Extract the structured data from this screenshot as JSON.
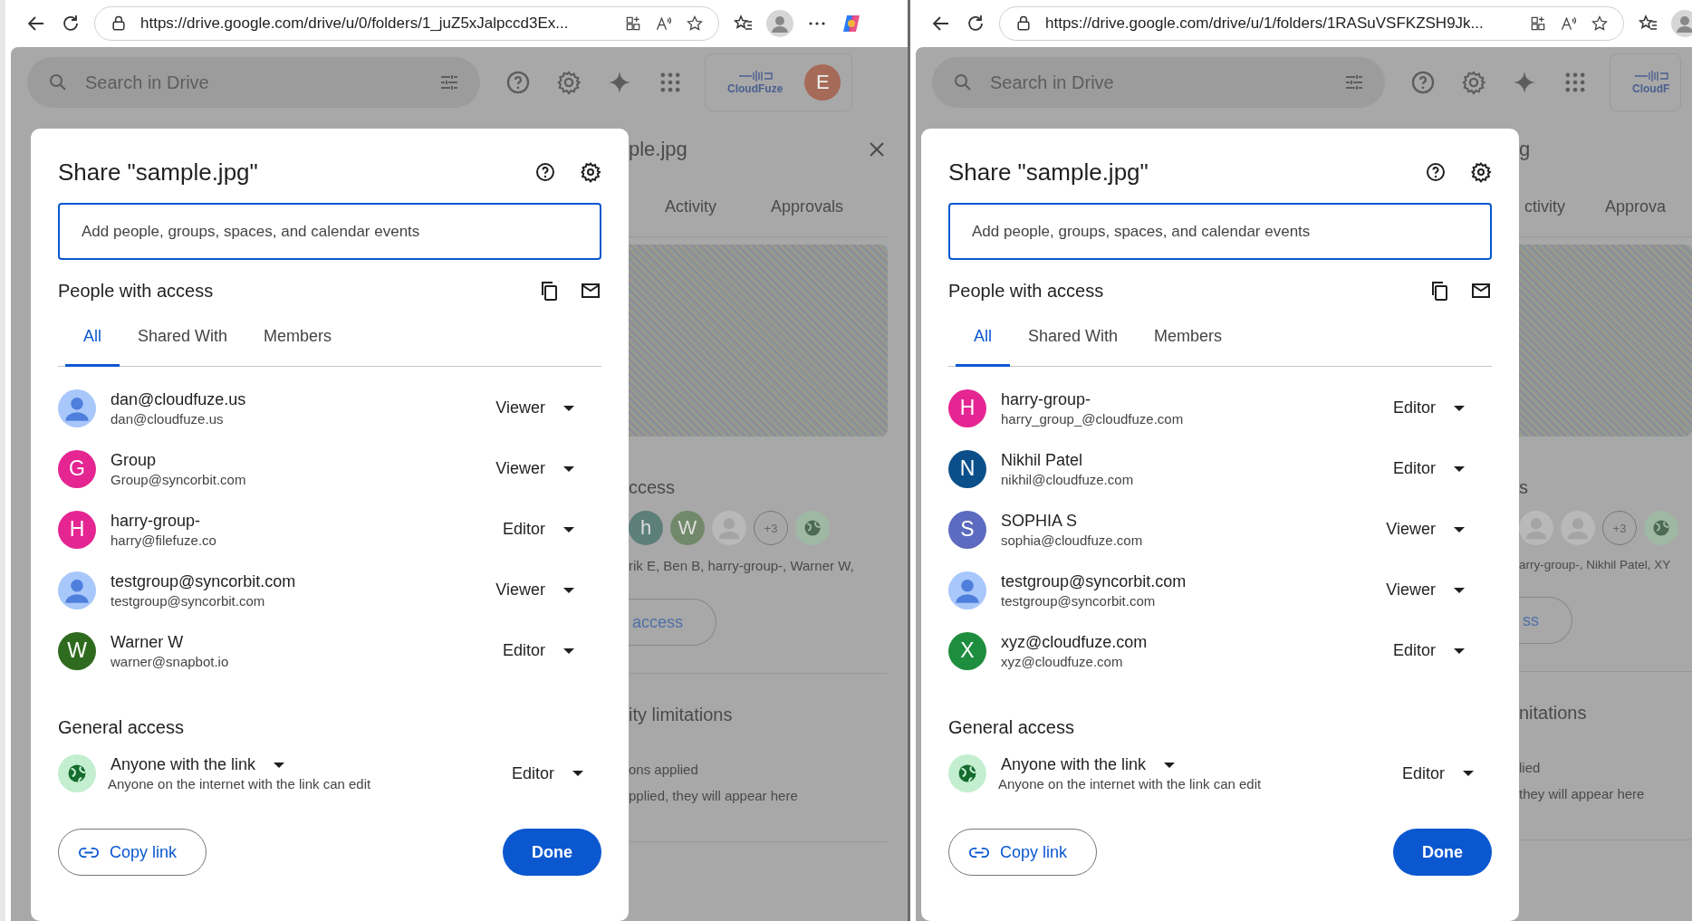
{
  "windows": [
    {
      "browser": {
        "url": "https://drive.google.com/drive/u/0/folders/1_juZ5xJalpccd3Ex..."
      },
      "drive_header": {
        "search": {
          "placeholder": "Search in Drive"
        },
        "logo_text": "CloudFuze",
        "avatar_letter": "E"
      },
      "details_panel": {
        "title": "ple.jpg",
        "close_visible": true,
        "tabs": [
          "Activity",
          "Approvals"
        ],
        "access_heading": "ccess",
        "avatars": [
          {
            "kind": "letter",
            "letter": "h",
            "color": "#5d7f7a"
          },
          {
            "kind": "letter",
            "letter": "W",
            "color": "#71896a"
          },
          {
            "kind": "person"
          },
          {
            "kind": "count",
            "letter": "+3"
          },
          {
            "kind": "globe"
          }
        ],
        "names": "rik E, Ben B, harry-group-, Warner W,",
        "manage_button": "access",
        "limits_heading": "ity limitations",
        "limits_line_1": "ons applied",
        "limits_line_2": "pplied, they will appear here"
      },
      "dialog": {
        "title": "Share \"sample.jpg\"",
        "input": {
          "placeholder": "Add people, groups, spaces, and calendar events"
        },
        "people_heading": "People with access",
        "tabs": [
          {
            "label": "All",
            "selected": true
          },
          {
            "label": "Shared With",
            "selected": false
          },
          {
            "label": "Members",
            "selected": false
          }
        ],
        "people": [
          {
            "name": "dan@cloudfuze.us",
            "email": "dan@cloudfuze.us",
            "role": "Viewer",
            "avatar": {
              "kind": "person"
            }
          },
          {
            "name": "Group",
            "email": "Group@syncorbit.com",
            "role": "Viewer",
            "avatar": {
              "kind": "letter",
              "letter": "G",
              "color": "#e52592"
            }
          },
          {
            "name": "harry-group-",
            "email": "harry@filefuze.co",
            "role": "Editor",
            "avatar": {
              "kind": "letter",
              "letter": "H",
              "color": "#e52592"
            }
          },
          {
            "name": "testgroup@syncorbit.com",
            "email": "testgroup@syncorbit.com",
            "role": "Viewer",
            "avatar": {
              "kind": "person"
            }
          },
          {
            "name": "Warner W",
            "email": "warner@snapbot.io",
            "role": "Editor",
            "avatar": {
              "kind": "letter",
              "letter": "W",
              "color": "#2e6b1f"
            }
          }
        ],
        "general_heading": "General access",
        "link": {
          "scope": "Anyone with the link",
          "description": "Anyone on the internet with the link can edit",
          "role": "Editor"
        },
        "copy_button": "Copy link",
        "done_button": "Done"
      }
    },
    {
      "browser": {
        "url": "https://drive.google.com/drive/u/1/folders/1RASuVSFKZSH9Jk..."
      },
      "drive_header": {
        "search": {
          "placeholder": "Search in Drive"
        },
        "logo_text": "CloudF"
      },
      "details_panel": {
        "title": "g",
        "close_visible": false,
        "tabs": [
          "ctivity",
          "Approva"
        ],
        "access_heading": "s",
        "avatars": [
          {
            "kind": "person"
          },
          {
            "kind": "person"
          },
          {
            "kind": "count",
            "letter": "+3"
          },
          {
            "kind": "globe"
          }
        ],
        "names": "arry-group-, Nikhil Patel, XY",
        "manage_button": "ss",
        "limits_heading": "nitations",
        "limits_line_1": "lied",
        "limits_line_2": "they will appear here"
      },
      "dialog": {
        "title": "Share \"sample.jpg\"",
        "input": {
          "placeholder": "Add people, groups, spaces, and calendar events"
        },
        "people_heading": "People with access",
        "tabs": [
          {
            "label": "All",
            "selected": true
          },
          {
            "label": "Shared With",
            "selected": false
          },
          {
            "label": "Members",
            "selected": false
          }
        ],
        "people": [
          {
            "name": "harry-group-",
            "email": "harry_group_@cloudfuze.com",
            "role": "Editor",
            "avatar": {
              "kind": "letter",
              "letter": "H",
              "color": "#e52592"
            }
          },
          {
            "name": "Nikhil Patel",
            "email": "nikhil@cloudfuze.com",
            "role": "Editor",
            "avatar": {
              "kind": "letter",
              "letter": "N",
              "color": "#0b4f8a"
            }
          },
          {
            "name": "SOPHIA S",
            "email": "sophia@cloudfuze.com",
            "role": "Viewer",
            "avatar": {
              "kind": "letter",
              "letter": "S",
              "color": "#5c6bc0"
            }
          },
          {
            "name": "testgroup@syncorbit.com",
            "email": "testgroup@syncorbit.com",
            "role": "Viewer",
            "avatar": {
              "kind": "person"
            }
          },
          {
            "name": "xyz@cloudfuze.com",
            "email": "xyz@cloudfuze.com",
            "role": "Editor",
            "avatar": {
              "kind": "letter",
              "letter": "X",
              "color": "#1e8e3e"
            }
          }
        ],
        "general_heading": "General access",
        "link": {
          "scope": "Anyone with the link",
          "description": "Anyone on the internet with the link can edit",
          "role": "Editor"
        },
        "copy_button": "Copy link",
        "done_button": "Done"
      }
    }
  ]
}
